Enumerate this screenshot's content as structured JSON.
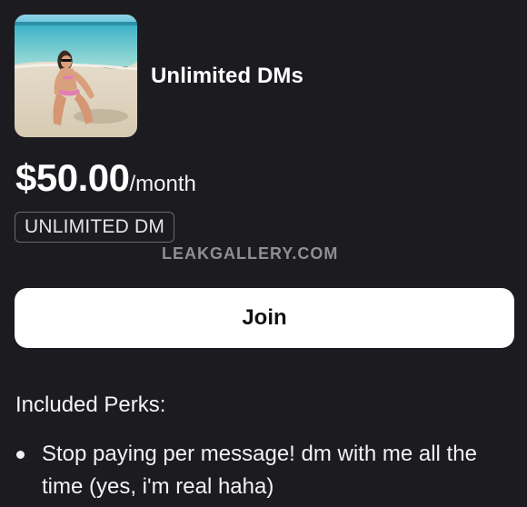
{
  "tier": {
    "image_alt": "beach photo",
    "title": "Unlimited DMs",
    "price": "$50.00",
    "period": "/month",
    "badge": "UNLIMITED DM"
  },
  "watermark": "LEAKGALLERY.COM",
  "join_button": {
    "label": "Join"
  },
  "perks": {
    "heading": "Included Perks:",
    "items": [
      "Stop paying per message! dm with me all the time (yes, i'm real haha)"
    ]
  },
  "colors": {
    "background": "#1c1b1f",
    "button_bg": "#ffffff",
    "button_text": "#111111",
    "badge_border": "#6a6a6e",
    "watermark": "#8f8f93"
  }
}
